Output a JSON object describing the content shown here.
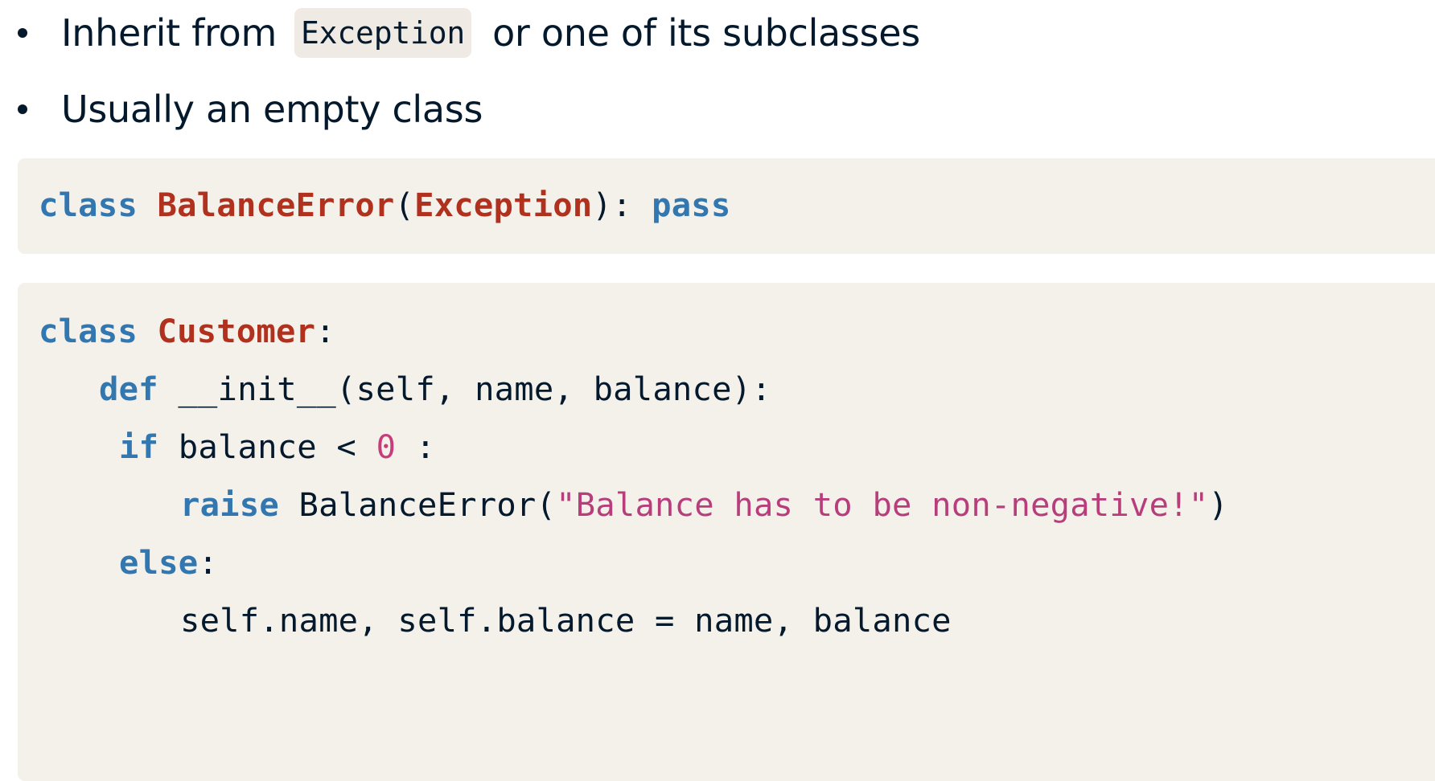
{
  "bullets": [
    {
      "text_before": "Inherit from",
      "code": "Exception",
      "text_after": "or one of its subclasses"
    },
    {
      "text": "Usually an empty class"
    }
  ],
  "code_block_1": {
    "line1": {
      "kw_class": "class",
      "class_name": "BalanceError",
      "paren_open": "(",
      "base_class": "Exception",
      "paren_close": "):",
      "kw_pass": "pass"
    }
  },
  "code_block_2": {
    "line1": {
      "kw_class": "class",
      "class_name": "Customer",
      "colon": ":"
    },
    "line2": {
      "kw_def": "def",
      "signature": "__init__(self, name, balance):"
    },
    "line3": {
      "kw_if": "if",
      "expr": "balance <",
      "number": "0",
      "colon": ":"
    },
    "line4": {
      "kw_raise": "raise",
      "call_open": "BalanceError(",
      "string": "\"Balance has to be non-negative!\"",
      "call_close": ")"
    },
    "line5": {
      "kw_else": "else",
      "colon": ":"
    },
    "line6": {
      "statement": "self.name, self.balance = name, balance"
    }
  },
  "colors": {
    "keyword": "#3277b0",
    "class_name": "#b0321e",
    "string": "#b73e7b",
    "number": "#c73c7a",
    "text": "#05192d",
    "code_background": "#f4f1eb",
    "inline_code_background": "#efebe4"
  }
}
